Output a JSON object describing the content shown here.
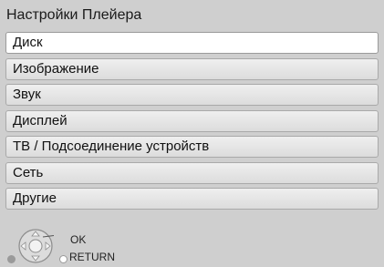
{
  "title": "Настройки Плейера",
  "menu": {
    "items": [
      {
        "label": "Диск"
      },
      {
        "label": "Изображение"
      },
      {
        "label": "Звук"
      },
      {
        "label": "Дисплей"
      },
      {
        "label": "ТВ / Подсоединение устройств"
      },
      {
        "label": "Сеть"
      },
      {
        "label": "Другие"
      }
    ]
  },
  "legend": {
    "ok": "OK",
    "return": "RETURN"
  },
  "icons": {
    "dpad": "dpad-icon",
    "return": "return-dot-icon"
  },
  "colors": {
    "background": "#cfcfcf",
    "selected": "#ffffff",
    "item": "#e6e6e6"
  }
}
